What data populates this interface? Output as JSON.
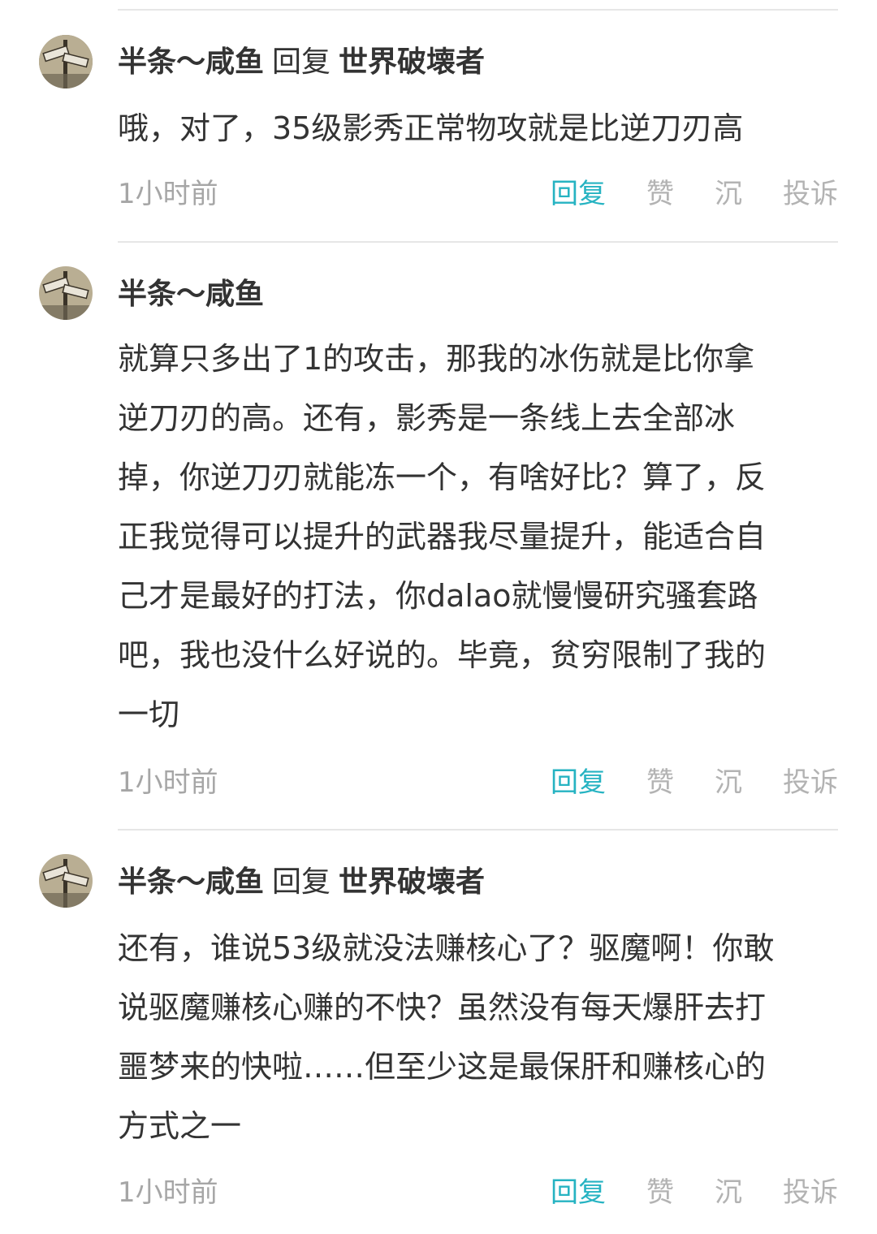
{
  "comments": [
    {
      "author": "半条～咸鱼",
      "reply_word": "回复",
      "reply_to": "世界破壊者",
      "text": "哦，对了，35级影秀正常物攻就是比逆刀刃高",
      "time": "1小时前",
      "actions": {
        "reply": "回复",
        "like": "赞",
        "sink": "沉",
        "report": "投诉"
      }
    },
    {
      "author": "半条～咸鱼",
      "reply_word": "",
      "reply_to": "",
      "text": "就算只多出了1的攻击，那我的冰伤就是比你拿\n逆刀刃的高。还有，影秀是一条线上去全部冰\n掉，你逆刀刃就能冻一个，有啥好比？算了，反\n正我觉得可以提升的武器我尽量提升，能适合自\n己才是最好的打法，你dalao就慢慢研究骚套路\n吧，我也没什么好说的。毕竟，贫穷限制了我的\n一切",
      "time": "1小时前",
      "actions": {
        "reply": "回复",
        "like": "赞",
        "sink": "沉",
        "report": "投诉"
      }
    },
    {
      "author": "半条～咸鱼",
      "reply_word": "回复",
      "reply_to": "世界破壊者",
      "text": "还有，谁说53级就没法赚核心了？驱魔啊！你敢\n说驱魔赚核心赚的不快？虽然没有每天爆肝去打\n噩梦来的快啦……但至少这是最保肝和赚核心的\n方式之一",
      "time": "1小时前",
      "actions": {
        "reply": "回复",
        "like": "赞",
        "sink": "沉",
        "report": "投诉"
      }
    }
  ],
  "colors": {
    "accent": "#26b3c2",
    "text": "#333333",
    "muted": "#a6a6a6",
    "divider": "#e6e6e6"
  },
  "icons": {
    "avatar": "user-avatar-street-sign"
  }
}
